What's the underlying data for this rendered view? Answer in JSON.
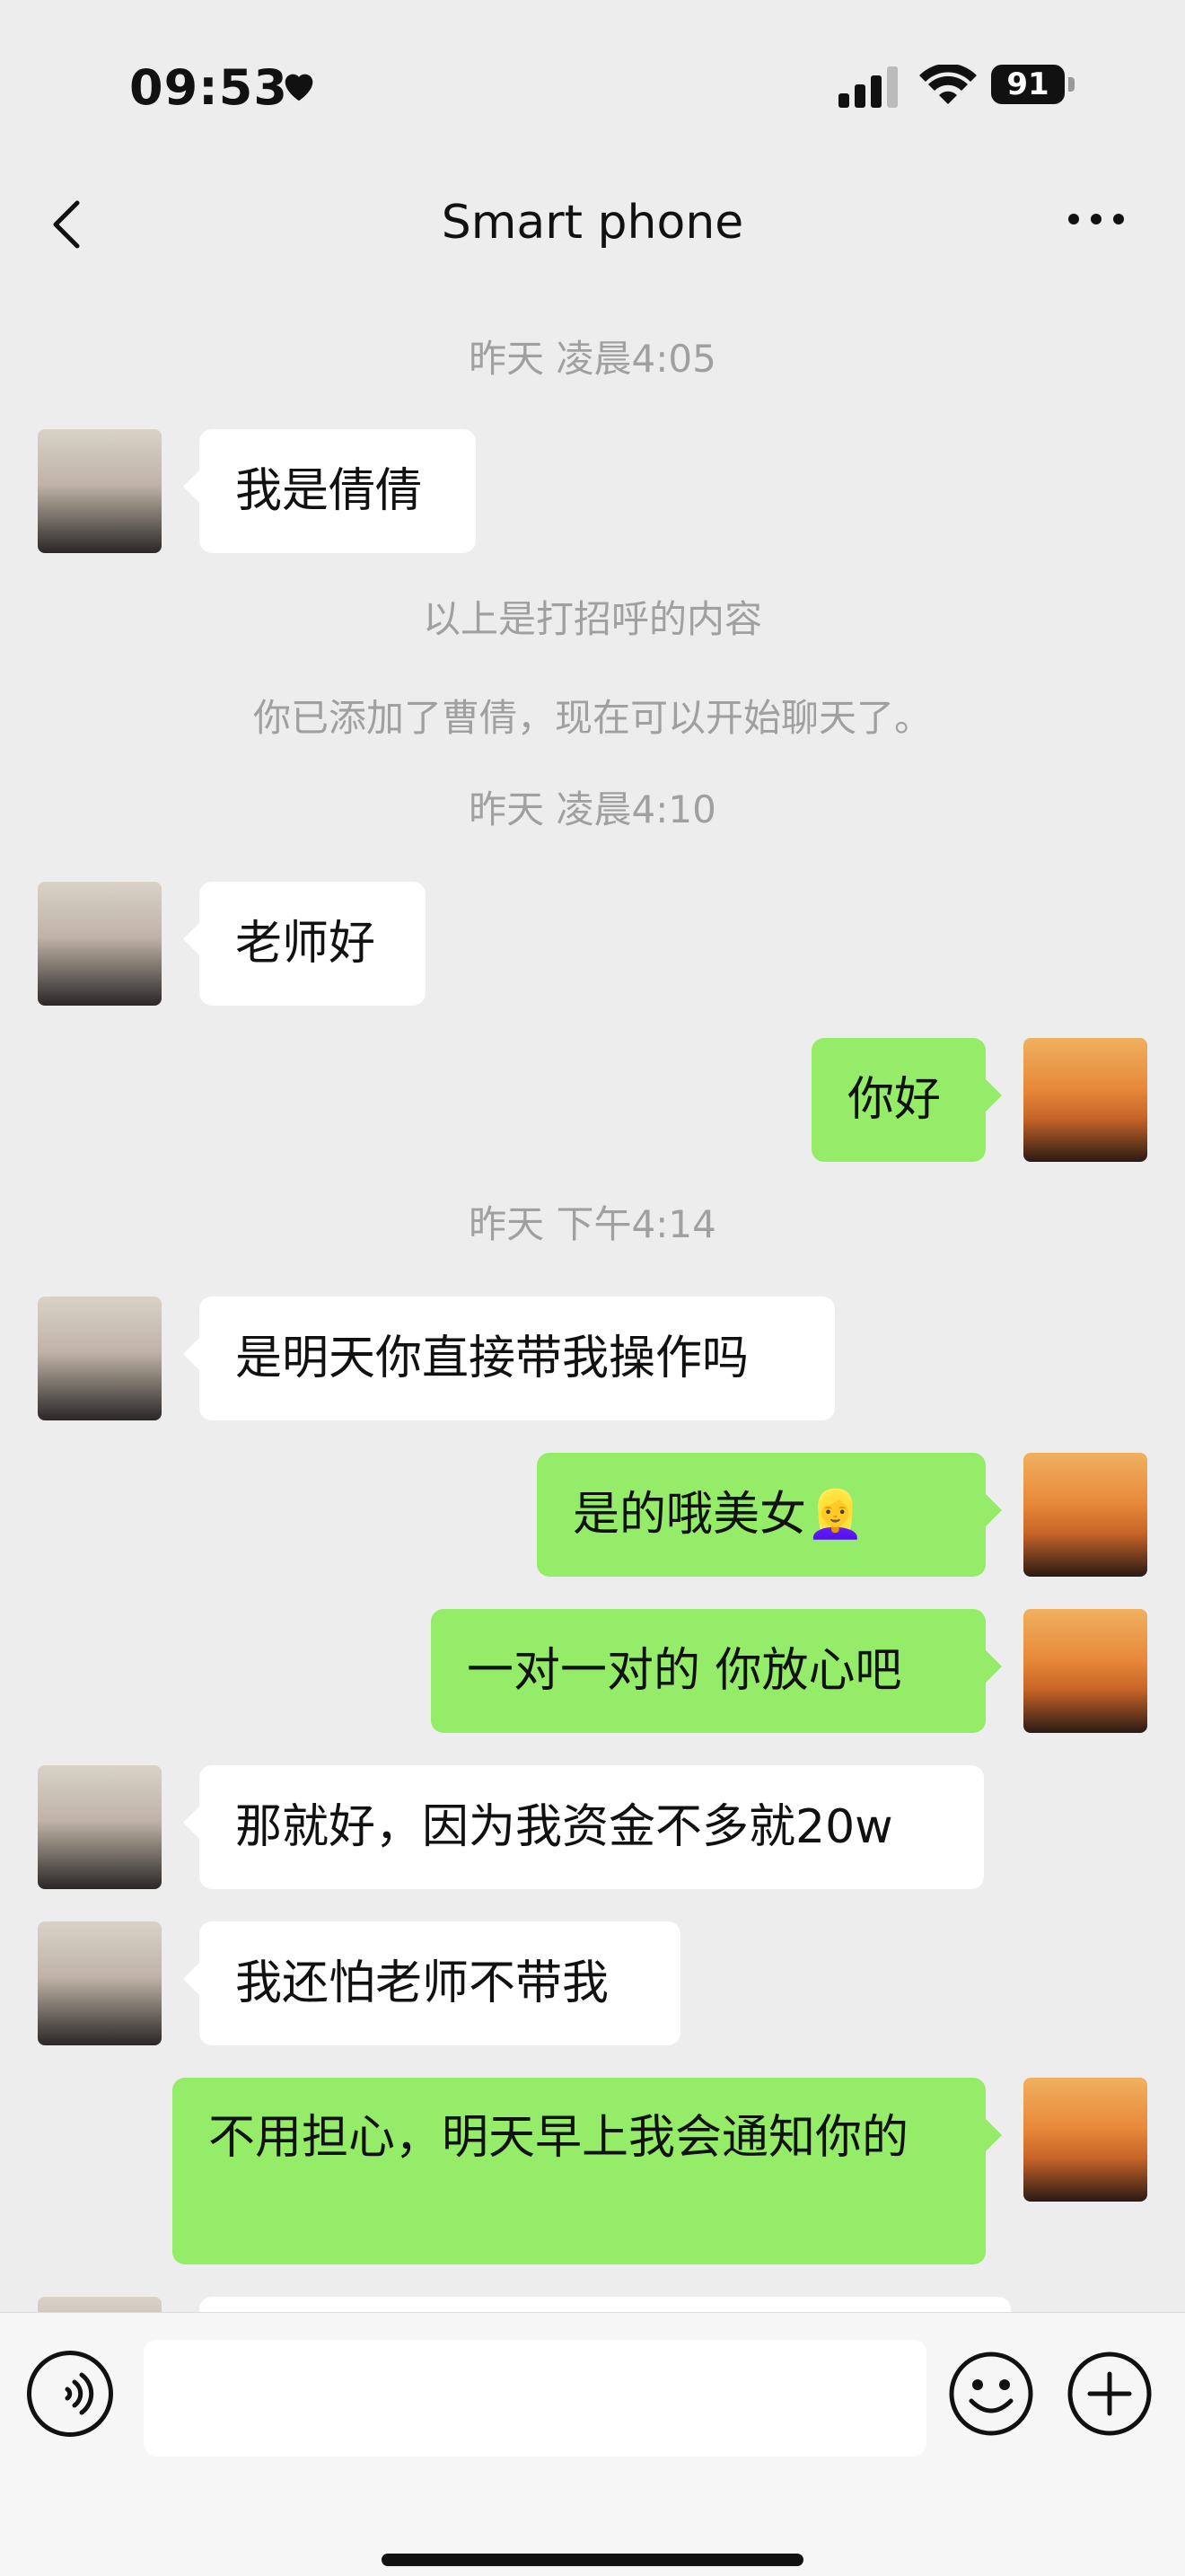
{
  "status_bar": {
    "time": "09:53",
    "battery": "91"
  },
  "nav": {
    "title": "Smart phone"
  },
  "messages": {
    "ts1": "昨天 凌晨4:05",
    "m1": "我是倩倩",
    "sys1": "以上是打招呼的内容",
    "sys2": "你已添加了曹倩，现在可以开始聊天了。",
    "ts2": "昨天 凌晨4:10",
    "m2": "老师好",
    "m3": "你好",
    "ts3": "昨天 下午4:14",
    "m4": "是明天你直接带我操作吗",
    "m5": "是的哦美女👱‍♀️",
    "m6": "一对一对的 你放心吧",
    "m7": "那就好，因为我资金不多就20w",
    "m8": "我还怕老师不带我",
    "m9": "不用担心，明天早上我会通知你的"
  },
  "icons": [
    "heart-icon",
    "signal-icon",
    "wifi-icon",
    "battery-icon",
    "back-icon",
    "more-icon",
    "voice-icon",
    "emoji-icon",
    "plus-icon"
  ]
}
